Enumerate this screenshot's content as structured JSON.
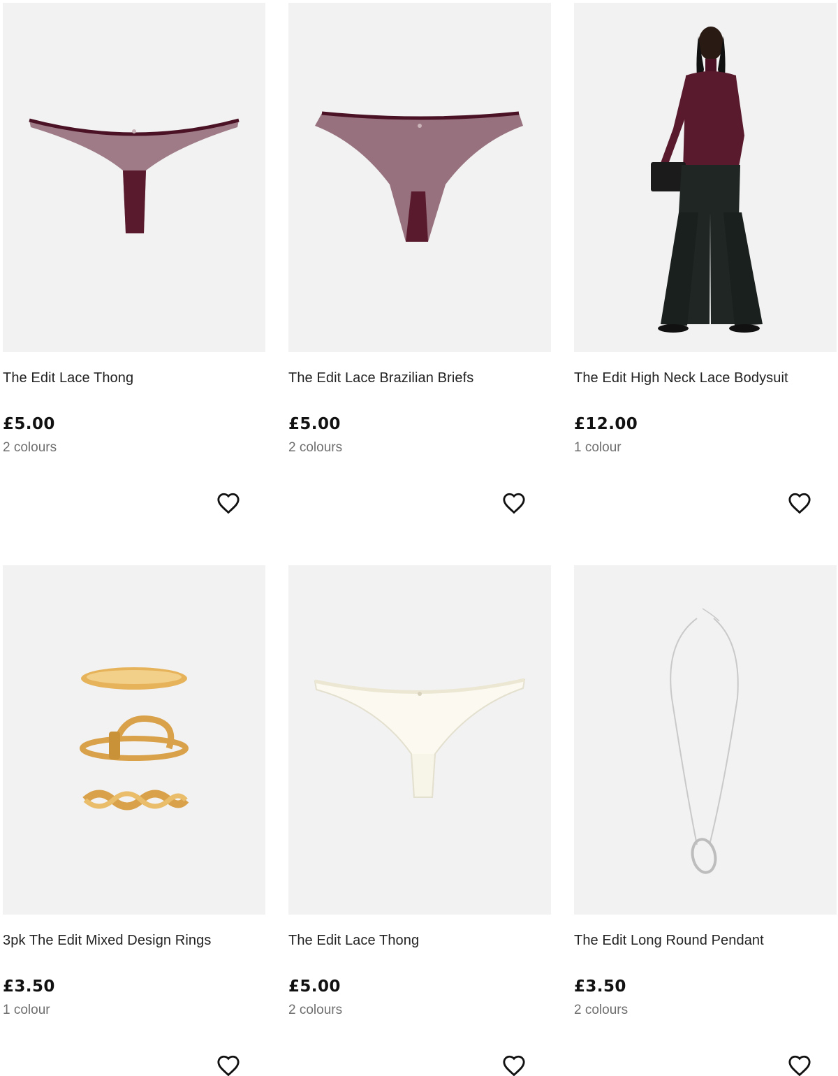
{
  "products": [
    {
      "title": "The Edit Lace Thong",
      "price": "£5.00",
      "colours": "2 colours",
      "image": "burgundy-lace-thong",
      "wishlist_icon": "heart-outline-icon"
    },
    {
      "title": "The Edit Lace Brazilian Briefs",
      "price": "£5.00",
      "colours": "2 colours",
      "image": "burgundy-lace-brazilian-briefs",
      "wishlist_icon": "heart-outline-icon"
    },
    {
      "title": "The Edit High Neck Lace Bodysuit",
      "price": "£12.00",
      "colours": "1 colour",
      "image": "model-in-burgundy-bodysuit",
      "wishlist_icon": "heart-outline-icon"
    },
    {
      "title": "3pk The Edit Mixed Design Rings",
      "price": "£3.50",
      "colours": "1 colour",
      "image": "gold-rings-set",
      "wishlist_icon": "heart-outline-icon"
    },
    {
      "title": "The Edit Lace Thong",
      "price": "£5.00",
      "colours": "2 colours",
      "image": "ivory-lace-thong",
      "wishlist_icon": "heart-outline-icon"
    },
    {
      "title": "The Edit Long Round Pendant",
      "price": "£3.50",
      "colours": "2 colours",
      "image": "silver-long-pendant",
      "wishlist_icon": "heart-outline-icon"
    }
  ],
  "colors": {
    "image_bg": "#f2f2f2",
    "burgundy": "#5a1a2e",
    "gold": "#d9a24a",
    "ivory": "#f4f1e6",
    "silver": "#c9c9c9",
    "text": "#222222",
    "muted": "#6e6e6e"
  }
}
